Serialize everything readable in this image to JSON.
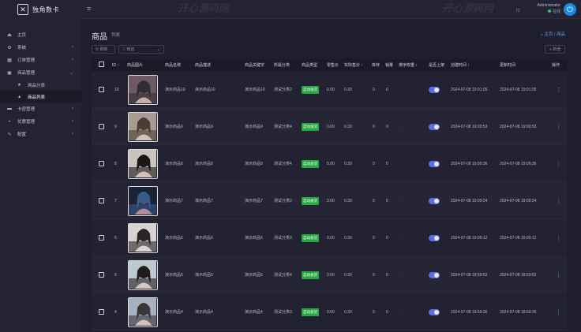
{
  "brand": {
    "logo_glyph": "✕",
    "name": "独角数卡"
  },
  "topbar": {
    "menu_glyph": "≡",
    "watermark_1": "开心源码网",
    "watermark_2": "开心源码网",
    "theme_glyph": "☼",
    "user_name": "Administrator",
    "user_status": "在线",
    "power_glyph": "⏻"
  },
  "sidebar": {
    "items": [
      {
        "label": "主页",
        "icon": "⏏",
        "chev": ""
      },
      {
        "label": "系统",
        "icon": "⚙",
        "chev": "‹"
      },
      {
        "label": "订单管理",
        "icon": "▦",
        "chev": "‹"
      },
      {
        "label": "商品管理",
        "icon": "▣",
        "chev": "⌄"
      },
      {
        "label": "卡密管理",
        "icon": "▬",
        "chev": "‹"
      },
      {
        "label": "优惠管理",
        "icon": "◒",
        "chev": "‹"
      },
      {
        "label": "配置",
        "icon": "✎",
        "chev": "‹"
      }
    ],
    "sub_items": [
      {
        "label": "商品分类",
        "icon": "★"
      },
      {
        "label": "商品列表",
        "icon": "▲"
      }
    ]
  },
  "page": {
    "title": "商品",
    "subtitle": "列表",
    "breadcrumb_home": "⌂ 主页",
    "breadcrumb_sep": " / ",
    "breadcrumb_current": "商品"
  },
  "toolbar": {
    "refresh_label": "⟳ 刷新",
    "filter_label": "▽ 筛选",
    "filter_caret": "⌄",
    "add_label": "+ 新增"
  },
  "table": {
    "headers": {
      "id": "ID ↑",
      "image": "商品图片",
      "name": "商品名称",
      "desc": "商品描述",
      "keywords": "商品关键字",
      "category": "所属分类",
      "type": "商品类型",
      "sell": "零售价",
      "actual": "实际售价 ↑",
      "stock": "库存",
      "sales": "销量",
      "order": "排序权重 ↕",
      "onsale": "是否上架",
      "created": "创建时间 ↑",
      "updated": "更新时间",
      "action": "操作"
    },
    "rows": [
      {
        "id": "10",
        "name": "演示商品10",
        "desc": "演示商品10",
        "keywords": "演示商品10",
        "category": "测试分类2",
        "type": "自动发货",
        "sell": "0.00",
        "actual": "0.30",
        "stock": "0",
        "sales": "0",
        "order": "⋮",
        "created": "2024-07-08 19:01:05",
        "updated": "2024-07-08 19:01:05",
        "img": {
          "bg": "#6d5a63",
          "fg": "#d9c2bd",
          "accent": "#332c35"
        }
      },
      {
        "id": "9",
        "name": "演示商品9",
        "desc": "演示商品9",
        "keywords": "演示商品9",
        "category": "测试分类4",
        "type": "自动发货",
        "sell": "0.00",
        "actual": "0.30",
        "stock": "0",
        "sales": "0",
        "order": "⋮",
        "created": "2024-07-08 19:00:53",
        "updated": "2024-07-08 19:00:53",
        "img": {
          "bg": "#a89b91",
          "fg": "#e6d2c5",
          "accent": "#4a3d36"
        }
      },
      {
        "id": "8",
        "name": "演示商品8",
        "desc": "演示商品8",
        "keywords": "演示商品8",
        "category": "测试分类4",
        "type": "自动发货",
        "sell": "0.00",
        "actual": "0.30",
        "stock": "0",
        "sales": "0",
        "order": "⋮",
        "created": "2024-07-08 19:00:36",
        "updated": "2024-07-08 19:00:36",
        "img": {
          "bg": "#c9c4c0",
          "fg": "#e8d3c8",
          "accent": "#1b1715"
        }
      },
      {
        "id": "7",
        "name": "演示商品7",
        "desc": "演示商品7",
        "keywords": "演示商品7",
        "category": "测试分类2",
        "type": "自动发货",
        "sell": "0.00",
        "actual": "0.30",
        "stock": "0",
        "sales": "0",
        "order": "⋮",
        "created": "2024-07-08 19:00:24",
        "updated": "2024-07-08 19:00:24",
        "img": {
          "bg": "#1a2235",
          "fg": "#c99aa6",
          "accent": "#3a5a8a"
        }
      },
      {
        "id": "6",
        "name": "演示商品6",
        "desc": "演示商品6",
        "keywords": "演示商品6",
        "category": "测试分类3",
        "type": "自动发货",
        "sell": "0.00",
        "actual": "0.30",
        "stock": "0",
        "sales": "0",
        "order": "⋮",
        "created": "2024-07-08 19:00:12",
        "updated": "2024-07-08 19:00:12",
        "img": {
          "bg": "#d8d2d2",
          "fg": "#efe6e2",
          "accent": "#2a2424"
        }
      },
      {
        "id": "5",
        "name": "演示商品5",
        "desc": "演示商品5",
        "keywords": "演示商品5",
        "category": "测试分类4",
        "type": "自动发货",
        "sell": "0.00",
        "actual": "0.30",
        "stock": "0",
        "sales": "0",
        "order": "⋮",
        "created": "2024-07-08 18:59:52",
        "updated": "2024-07-08 18:59:52",
        "img": {
          "bg": "#bfc9d2",
          "fg": "#ead8cc",
          "accent": "#211c1c"
        }
      },
      {
        "id": "4",
        "name": "演示商品4",
        "desc": "演示商品4",
        "keywords": "演示商品4",
        "category": "测试分类3",
        "type": "自动发货",
        "sell": "0.00",
        "actual": "0.30",
        "stock": "0",
        "sales": "0",
        "order": "⋮",
        "created": "2024-07-08 18:59:36",
        "updated": "2024-07-08 18:59:36",
        "img": {
          "bg": "#a7b0c2",
          "fg": "#e5cfc1",
          "accent": "#3a3538"
        }
      }
    ]
  },
  "colors": {
    "accent": "#1e88e5",
    "tag": "#28a745",
    "toggle": "#5b6ee1",
    "link": "#5aa9f0"
  }
}
